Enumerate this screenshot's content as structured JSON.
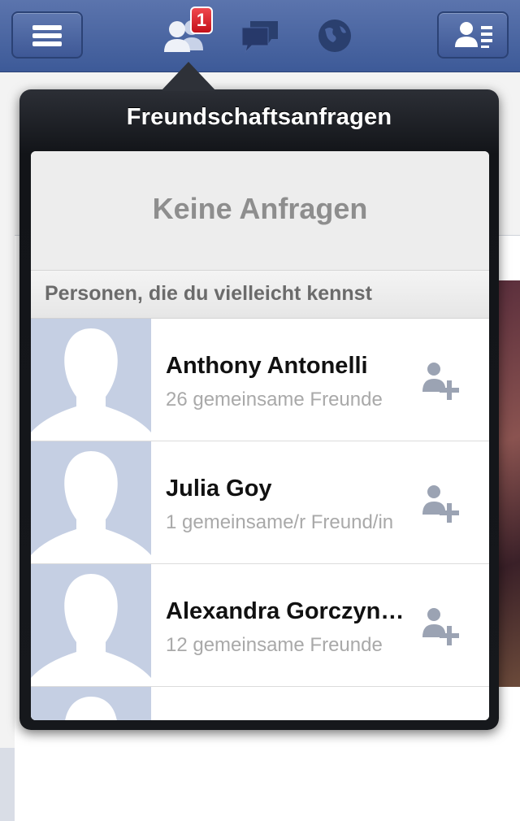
{
  "navbar": {
    "menu_icon": "hamburger-icon",
    "friends_icon": "friends-icon",
    "messages_icon": "messages-icon",
    "notifications_icon": "globe-icon",
    "contacts_icon": "contacts-icon",
    "friend_requests_badge": "1"
  },
  "popover": {
    "title": "Freundschaftsanfragen",
    "empty_text": "Keine Anfragen",
    "section_header": "Personen, die du vielleicht kennst",
    "people": [
      {
        "name": "Anthony Antonelli",
        "mutual": "26 gemeinsame Freunde"
      },
      {
        "name": "Julia Goy",
        "mutual": "1 gemeinsame/r Freund/in"
      },
      {
        "name": "Alexandra Gorczynski",
        "mutual": "12 gemeinsame Freunde"
      },
      {
        "name": "",
        "mutual": ""
      }
    ]
  },
  "colors": {
    "navbar": "#3d5a98",
    "badge": "#d4141d",
    "avatar_bg": "#c5cfe3"
  }
}
